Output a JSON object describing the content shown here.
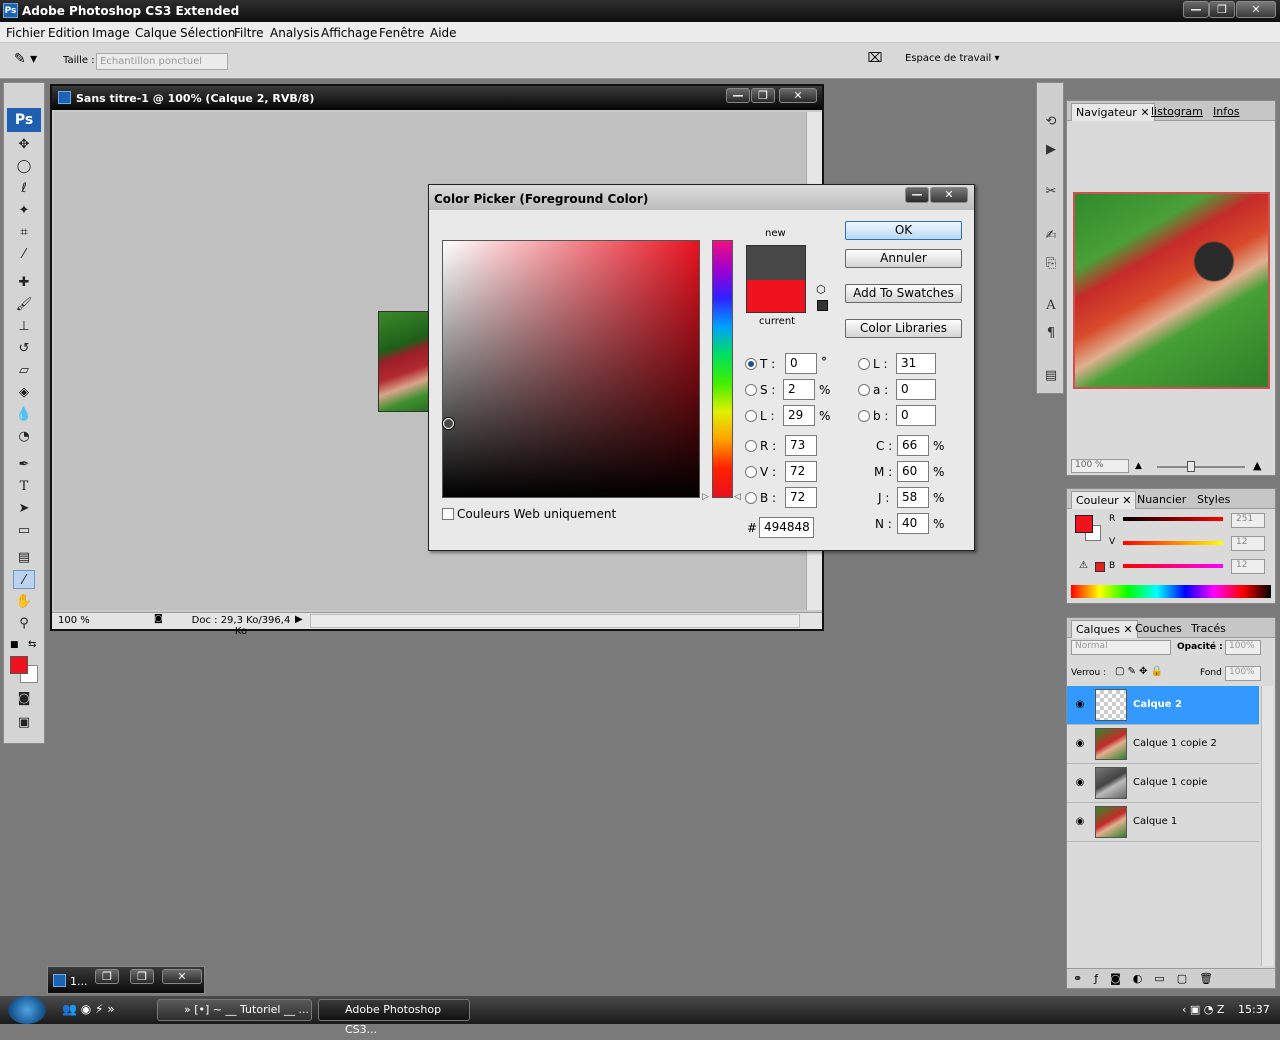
{
  "app": {
    "title": "Adobe Photoshop CS3 Extended",
    "logo": "Ps"
  },
  "window_controls": {
    "minimize": "—",
    "maximize": "❐",
    "close": "✕"
  },
  "menu": [
    "Fichier",
    "Edition",
    "Image",
    "Calque",
    "Sélection",
    "Filtre",
    "Analysis",
    "Affichage",
    "Fenêtre",
    "Aide"
  ],
  "options": {
    "size_label": "Taille :",
    "size_value": "Echantillon ponctuel",
    "workspace": "Espace de travail"
  },
  "toolbox": {
    "ps": "Ps"
  },
  "document": {
    "title": "Sans titre-1 @ 100% (Calque 2, RVB/8)",
    "zoom": "100 %",
    "doc_info": "Doc : 29,3 Ko/396,4 Ko"
  },
  "dialog": {
    "title": "Color Picker (Foreground Color)",
    "new_label": "new",
    "current_label": "current",
    "buttons": {
      "ok": "OK",
      "cancel": "Annuler",
      "add_swatches": "Add To Swatches",
      "libraries": "Color Libraries"
    },
    "hsb": {
      "h_label": "T :",
      "h": "0",
      "h_unit": "°",
      "s_label": "S :",
      "s": "2",
      "s_unit": "%",
      "l_label": "L :",
      "l": "29",
      "l_unit": "%"
    },
    "rgb": {
      "r_label": "R :",
      "r": "73",
      "g_label": "V :",
      "g": "72",
      "b_label": "B :",
      "b": "72"
    },
    "lab": {
      "l_label": "L :",
      "l": "31",
      "a_label": "a :",
      "a": "0",
      "b_label": "b :",
      "b": "0"
    },
    "cmyk": {
      "c_label": "C :",
      "c": "66",
      "m_label": "M :",
      "m": "60",
      "y_label": "J :",
      "y": "58",
      "k_label": "N :",
      "k": "40",
      "unit": "%"
    },
    "hex_label": "#",
    "hex": "494848",
    "web_only": "Couleurs Web uniquement",
    "new_color": "#494848",
    "current_color": "#ef1320"
  },
  "navigator": {
    "tabs": [
      "Navigateur",
      "listogram",
      "Infos"
    ],
    "zoom": "100 %"
  },
  "color_panel": {
    "tabs": [
      "Couleur",
      "Nuancier",
      "Styles"
    ],
    "r_label": "R",
    "r": "251",
    "g_label": "V",
    "g": "12",
    "b_label": "B",
    "b": "12"
  },
  "layers_panel": {
    "tabs": [
      "Calques",
      "Couches",
      "Tracés"
    ],
    "blend": "Normal",
    "opacity_label": "Opacité :",
    "opacity": "100%",
    "lock_label": "Verrou :",
    "fill_label": "Fond :",
    "fill": "100%",
    "layers": [
      {
        "name": "Calque 2",
        "selected": true
      },
      {
        "name": "Calque 1 copie 2",
        "selected": false
      },
      {
        "name": "Calque 1 copie",
        "selected": false
      },
      {
        "name": "Calque 1",
        "selected": false
      }
    ]
  },
  "minimized_doc": {
    "label": "1..."
  },
  "taskbar": {
    "firefox_task": "» [•] ~ __ Tutoriel __ ...",
    "ps_task": "Adobe Photoshop CS3...",
    "clock": "15:37"
  },
  "colors": {
    "foreground": "#ef1320",
    "selection_blue": "#3399ff"
  }
}
